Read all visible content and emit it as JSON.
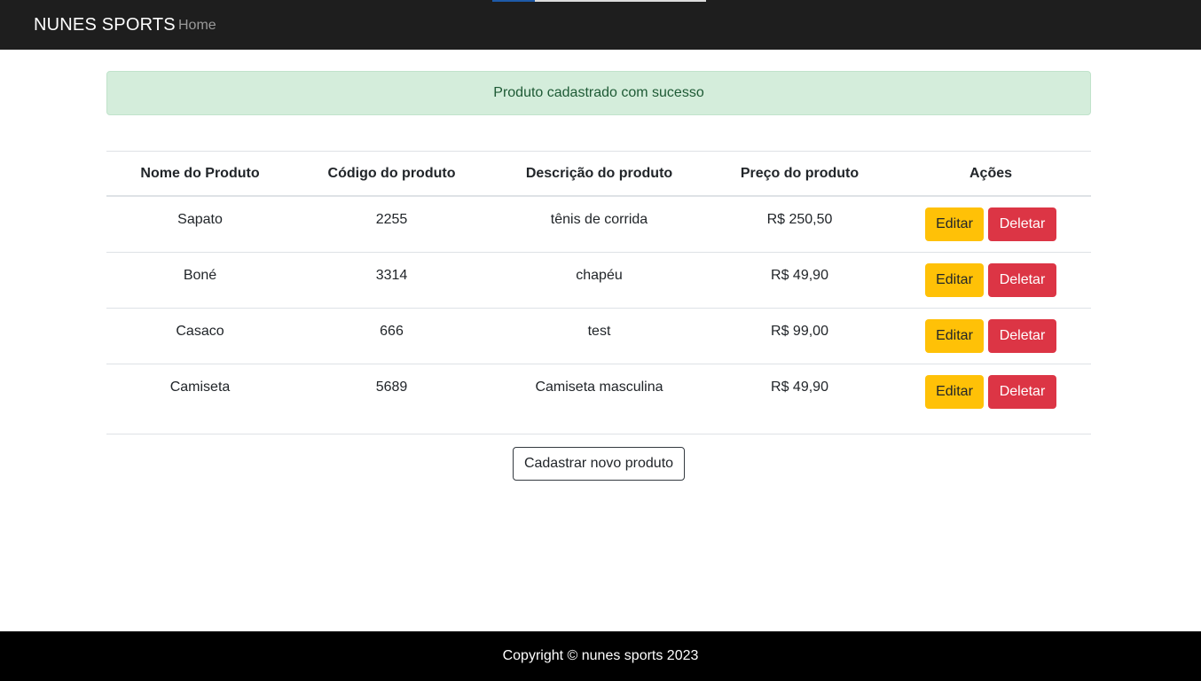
{
  "navbar": {
    "brand": "NUNES SPORTS",
    "links": [
      {
        "label": "Home"
      }
    ],
    "loading_progress": 0.2
  },
  "alert": {
    "message": "Produto cadastrado com sucesso"
  },
  "table": {
    "headers": [
      "Nome do Produto",
      "Código do produto",
      "Descrição do produto",
      "Preço do produto",
      "Ações"
    ],
    "rows": [
      {
        "nome": "Sapato",
        "codigo": "2255",
        "descricao": "tênis de corrida",
        "preco": "R$ 250,50"
      },
      {
        "nome": "Boné",
        "codigo": "3314",
        "descricao": "chapéu",
        "preco": "R$ 49,90"
      },
      {
        "nome": "Casaco",
        "codigo": "666",
        "descricao": "test",
        "preco": "R$ 99,00"
      },
      {
        "nome": "Camiseta",
        "codigo": "5689",
        "descricao": "Camiseta masculina",
        "preco": "R$ 49,90"
      }
    ],
    "edit_label": "Editar",
    "delete_label": "Deletar"
  },
  "new_product_button": "Cadastrar novo produto",
  "footer": {
    "copyright": "Copyright © nunes sports 2023"
  },
  "colors": {
    "navbar_bg": "#1e1e1e",
    "alert_bg": "#d4eddb",
    "edit_button": "#ffc107",
    "delete_button": "#dc3545",
    "footer_bg": "#000000"
  }
}
